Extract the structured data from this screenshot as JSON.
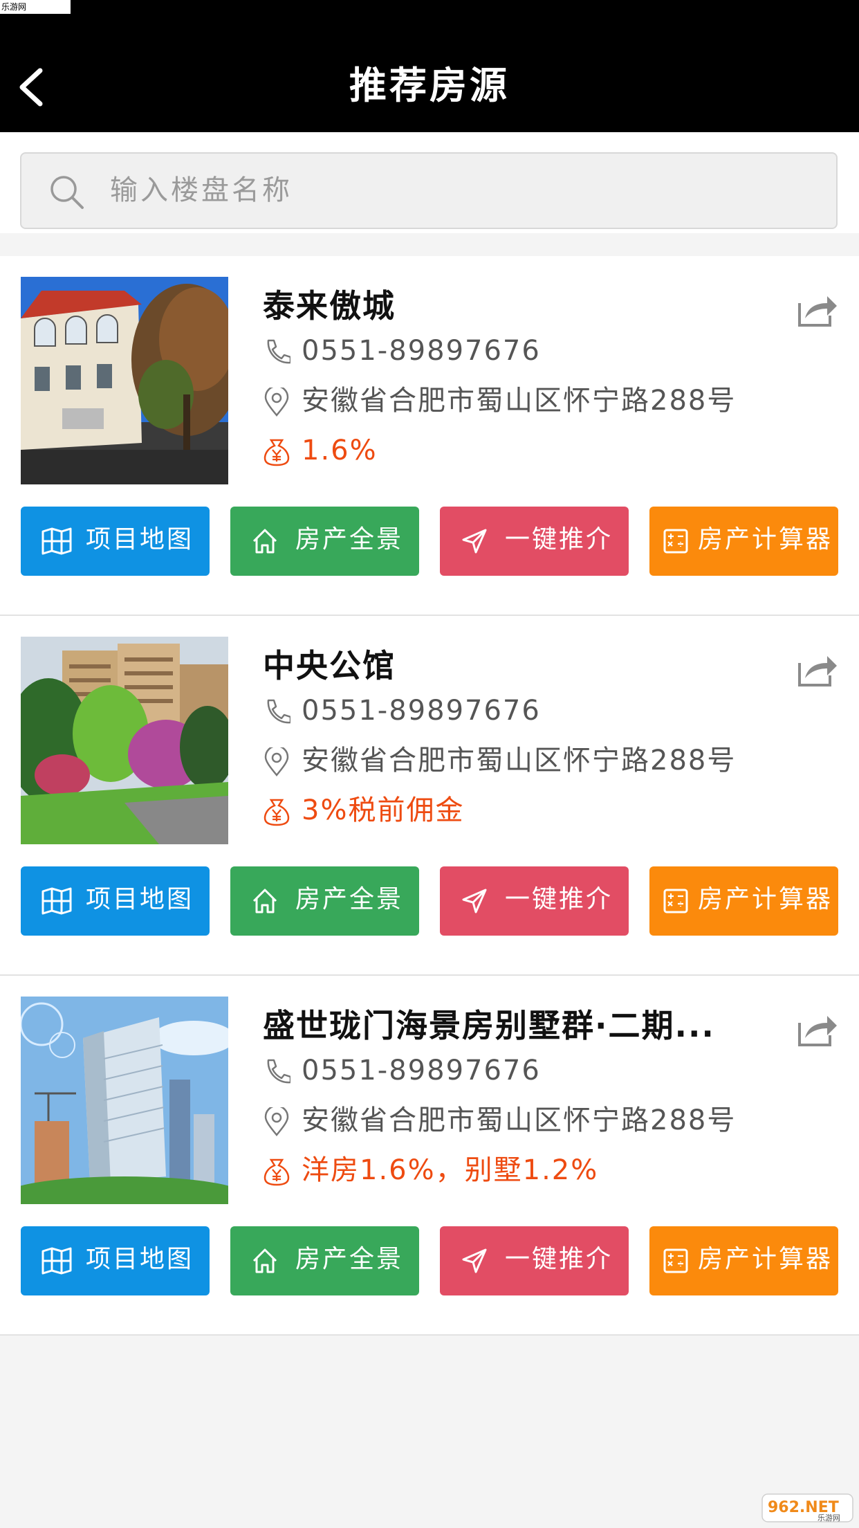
{
  "watermark": "乐游网 www.962.net",
  "header": {
    "title": "推荐房源"
  },
  "search": {
    "placeholder": "输入楼盘名称"
  },
  "buttons": {
    "map": "项目地图",
    "panorama": "房产全景",
    "recommend": "一键推介",
    "calculator": "房产计算器"
  },
  "listings": [
    {
      "name": "泰来傲城",
      "phone": "0551-89897676",
      "address": "安徽省合肥市蜀山区怀宁路288号",
      "commission": "1.6%"
    },
    {
      "name": "中央公馆",
      "phone": "0551-89897676",
      "address": "安徽省合肥市蜀山区怀宁路288号",
      "commission": "3%税前佣金"
    },
    {
      "name": "盛世珑门海景房别墅群·二期...",
      "phone": "0551-89897676",
      "address": "安徽省合肥市蜀山区怀宁路288号",
      "commission": "洋房1.6%，别墅1.2%"
    }
  ],
  "footer_logo": {
    "text": "962.NET",
    "subtext": "乐游网"
  },
  "colors": {
    "header_bg": "#000000",
    "map_button": "#0f92e3",
    "panorama_button": "#38a85a",
    "recommend_button": "#e24d64",
    "calculator_button": "#fb8a0c",
    "commission_text": "#ee4b11"
  },
  "icons": {
    "back": "chevron-left-icon",
    "search": "search-icon",
    "share": "share-icon",
    "phone": "phone-icon",
    "location": "location-pin-icon",
    "commission": "money-bag-icon",
    "map": "map-icon",
    "panorama": "home-icon",
    "recommend": "send-icon",
    "calculator": "calculator-icon"
  }
}
